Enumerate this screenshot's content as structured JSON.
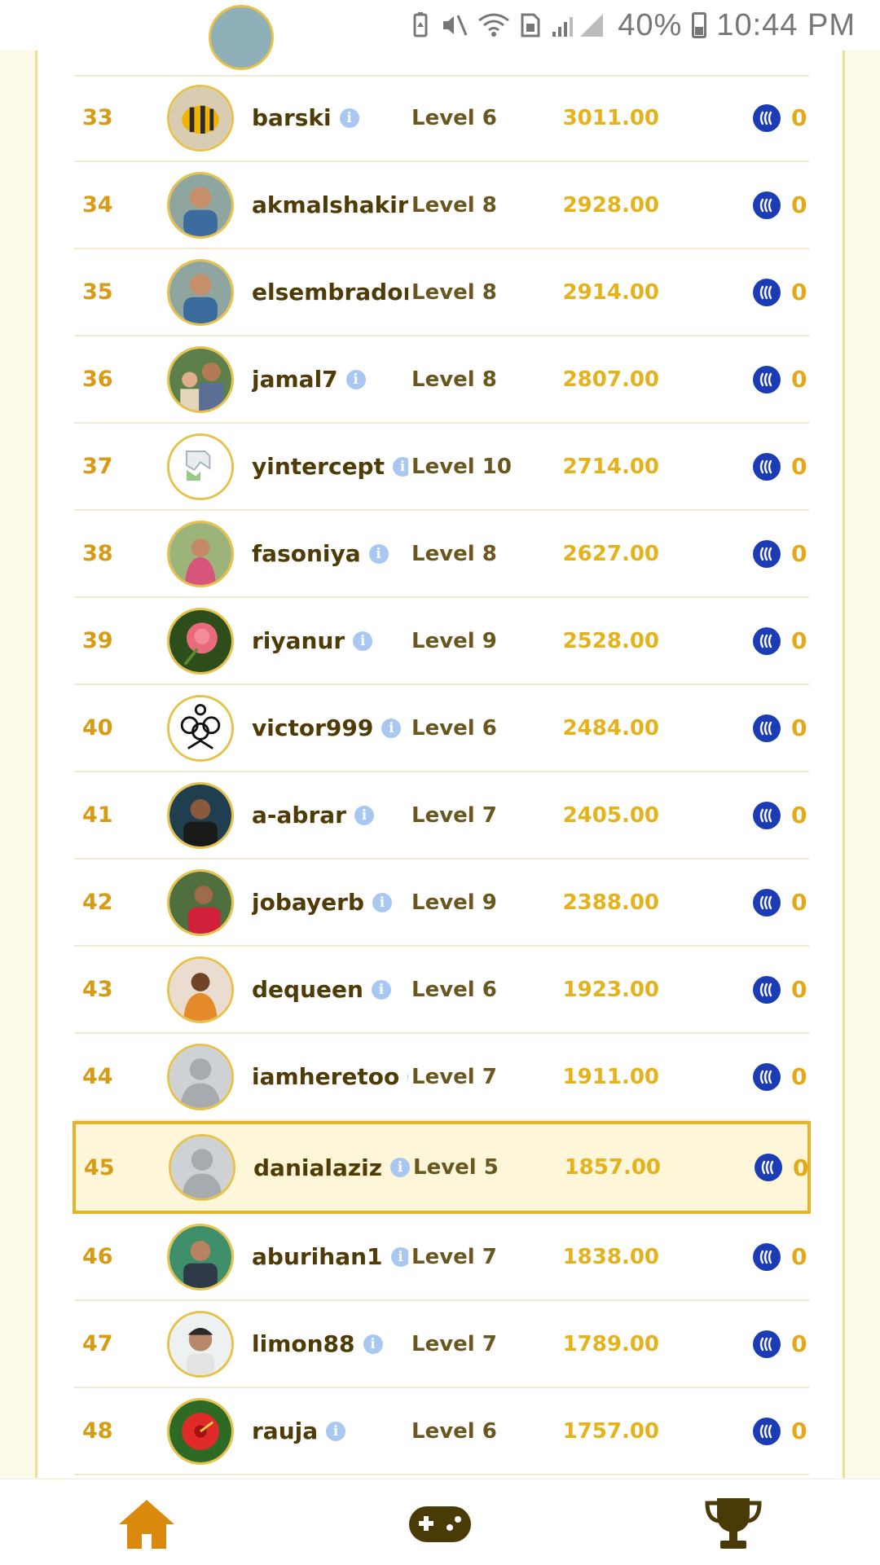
{
  "status_bar": {
    "battery": "40%",
    "time": "10:44 PM"
  },
  "rows": [
    {
      "rank": "33",
      "username": "barski",
      "level": "Level 6",
      "score": "3011.00",
      "reward": "0",
      "avatar": "bee"
    },
    {
      "rank": "34",
      "username": "akmalshakir",
      "level": "Level 8",
      "score": "2928.00",
      "reward": "0",
      "avatar": "man"
    },
    {
      "rank": "35",
      "username": "elsembrador",
      "level": "Level 8",
      "score": "2914.00",
      "reward": "0",
      "avatar": "man"
    },
    {
      "rank": "36",
      "username": "jamal7",
      "level": "Level 8",
      "score": "2807.00",
      "reward": "0",
      "avatar": "family"
    },
    {
      "rank": "37",
      "username": "yintercept",
      "level": "Level 10",
      "score": "2714.00",
      "reward": "0",
      "avatar": "broken"
    },
    {
      "rank": "38",
      "username": "fasoniya",
      "level": "Level 8",
      "score": "2627.00",
      "reward": "0",
      "avatar": "woman"
    },
    {
      "rank": "39",
      "username": "riyanur",
      "level": "Level 9",
      "score": "2528.00",
      "reward": "0",
      "avatar": "rose"
    },
    {
      "rank": "40",
      "username": "victor999",
      "level": "Level 6",
      "score": "2484.00",
      "reward": "0",
      "avatar": "logo"
    },
    {
      "rank": "41",
      "username": "a-abrar",
      "level": "Level 7",
      "score": "2405.00",
      "reward": "0",
      "avatar": "man-dark"
    },
    {
      "rank": "42",
      "username": "jobayerb",
      "level": "Level 9",
      "score": "2388.00",
      "reward": "0",
      "avatar": "man-red"
    },
    {
      "rank": "43",
      "username": "dequeen",
      "level": "Level 6",
      "score": "1923.00",
      "reward": "0",
      "avatar": "woman-orange"
    },
    {
      "rank": "44",
      "username": "iamheretoo",
      "level": "Level 7",
      "score": "1911.00",
      "reward": "0",
      "avatar": "default"
    },
    {
      "rank": "45",
      "username": "danialaziz",
      "level": "Level 5",
      "score": "1857.00",
      "reward": "0",
      "avatar": "default",
      "highlight": true
    },
    {
      "rank": "46",
      "username": "aburihan1",
      "level": "Level 7",
      "score": "1838.00",
      "reward": "0",
      "avatar": "man-green"
    },
    {
      "rank": "47",
      "username": "limon88",
      "level": "Level 7",
      "score": "1789.00",
      "reward": "0",
      "avatar": "boy"
    },
    {
      "rank": "48",
      "username": "rauja",
      "level": "Level 6",
      "score": "1757.00",
      "reward": "0",
      "avatar": "hibiscus"
    }
  ],
  "icons": {
    "info": "info-icon",
    "currency": "steem-icon"
  },
  "bottom_nav": [
    {
      "name": "home",
      "icon": "home-icon",
      "color": "#d98a0c"
    },
    {
      "name": "games",
      "icon": "gamepad-icon",
      "color": "#4a3a05"
    },
    {
      "name": "leaderboard",
      "icon": "trophy-icon",
      "color": "#4a3a05"
    }
  ],
  "colors": {
    "accent": "#e2b62a",
    "rank": "#d89b16",
    "score": "#e3b21c",
    "name": "#4f3b06",
    "currency": "#1b3cb4"
  }
}
